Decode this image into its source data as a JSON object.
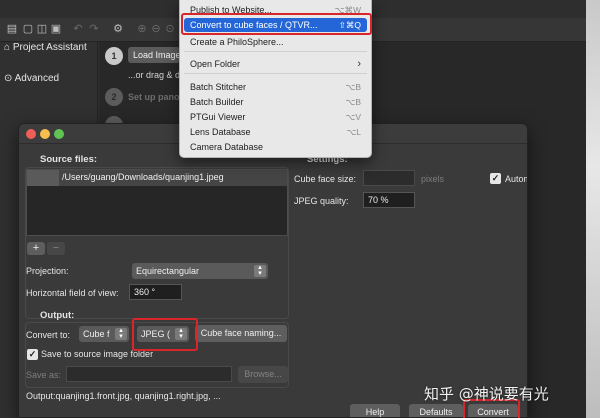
{
  "main_window": {
    "sidebar": {
      "project_assistant": "Project Assistant",
      "advanced": "Advanced"
    },
    "assistant": {
      "step1_number": "1",
      "load_images_label": "Load Image",
      "drag_hint": "...or drag & d",
      "step2_number": "2",
      "step2_label": "Set up pano"
    }
  },
  "dialog": {
    "source_files": {
      "title": "Source files:",
      "files": [
        "/Users/guang/Downloads/quanjing1.jpeg"
      ],
      "add_label": "+",
      "remove_label": "−"
    },
    "projection": {
      "label": "Projection:",
      "value": "Equirectangular"
    },
    "hfov": {
      "label": "Horizontal field of view:",
      "value": "360 °"
    },
    "settings": {
      "title": "Settings:",
      "cube_face_size_label": "Cube face size:",
      "cube_face_size_value": "",
      "pixels_label": "pixels",
      "automatic_label": "Automatic",
      "automatic_checked": true,
      "jpeg_quality_label": "JPEG quality:",
      "jpeg_quality_value": "70 %"
    },
    "output": {
      "title": "Output:",
      "convert_to_label": "Convert to:",
      "convert_to_value": "Cube f",
      "format_value": "JPEG (",
      "cube_face_naming_label": "Cube face naming...",
      "save_to_source_label": "Save to source image folder",
      "save_to_source_checked": true,
      "save_as_label": "Save as:",
      "save_as_value": "",
      "browse_label": "Browse...",
      "output_files": "Output:quanjing1.front.jpg, quanjing1.right.jpg, ..."
    },
    "buttons": {
      "help": "Help",
      "defaults": "Defaults",
      "convert": "Convert"
    }
  },
  "menu": {
    "items": [
      {
        "label": "Publish to Website...",
        "shortcut": "⌥⌘W"
      },
      {
        "label": "Convert to cube faces / QTVR...",
        "shortcut": "⇧⌘Q",
        "highlighted": true
      },
      {
        "label": "Create a PhiloSphere...",
        "shortcut": ""
      },
      {
        "label": "Open Folder",
        "shortcut": "›"
      },
      {
        "label": "Batch Stitcher",
        "shortcut": "⌥B"
      },
      {
        "label": "Batch Builder",
        "shortcut": "⌥B"
      },
      {
        "label": "PTGui Viewer",
        "shortcut": "⌥V"
      },
      {
        "label": "Lens Database",
        "shortcut": "⌥L"
      },
      {
        "label": "Camera Database",
        "shortcut": ""
      }
    ]
  },
  "watermark": "知乎 @神说要有光",
  "colors": {
    "menu_highlight": "#2466d8",
    "annotation_red": "#d9262c",
    "close": "#ee5f57",
    "minimize": "#f5be4f",
    "zoom": "#5fc454"
  }
}
